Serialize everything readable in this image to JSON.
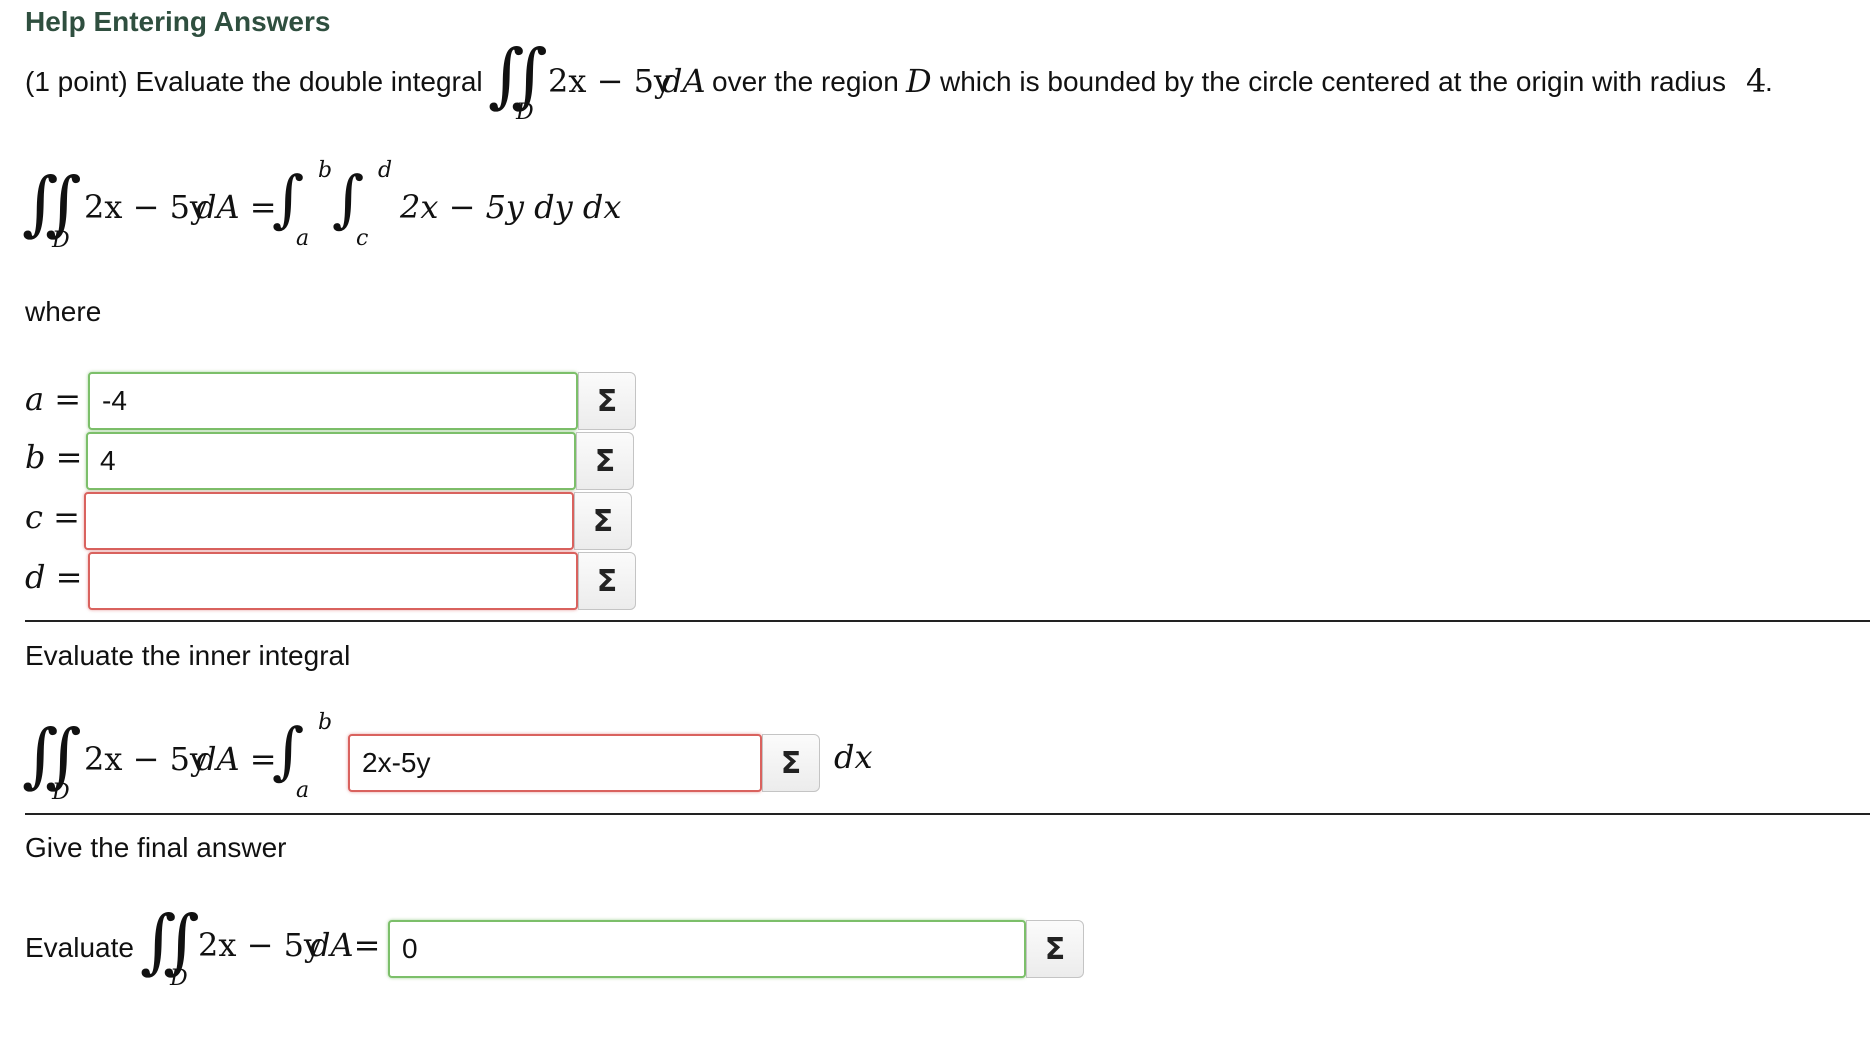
{
  "help_link": "Help Entering Answers",
  "problem": {
    "prefix": "(1 point) Evaluate the double integral",
    "integrand": "2x − 5y",
    "dA": "dA",
    "middle": "over the region",
    "region": "D",
    "suffix": "which is bounded by the circle centered at the origin with radius",
    "radius": "4",
    "period": "."
  },
  "setup": {
    "lhs_integrand": "2x − 5y",
    "lhs_dA": "dA =",
    "region": "D",
    "outer_upper": "b",
    "outer_lower": "a",
    "inner_upper": "d",
    "inner_lower": "c",
    "rhs": "2x − 5y dy dx"
  },
  "where_label": "where",
  "bounds": [
    {
      "label": "a =",
      "value": "-4",
      "status": "correct"
    },
    {
      "label": "b =",
      "value": "4",
      "status": "correct"
    },
    {
      "label": "c =",
      "value": "",
      "status": "incorrect"
    },
    {
      "label": "d =",
      "value": "",
      "status": "incorrect"
    }
  ],
  "sigma_glyph": "Σ",
  "inner": {
    "heading": "Evaluate the inner integral",
    "lhs_integrand": "2x − 5y",
    "lhs_dA": "dA =",
    "region": "D",
    "upper": "b",
    "lower": "a",
    "answer": "2x-5y",
    "status": "incorrect",
    "dx": "dx"
  },
  "final": {
    "heading": "Give the final answer",
    "evaluate_label": "Evaluate",
    "integrand": "2x − 5y",
    "dA": "dA=",
    "region": "D",
    "answer": "0",
    "status": "correct"
  }
}
